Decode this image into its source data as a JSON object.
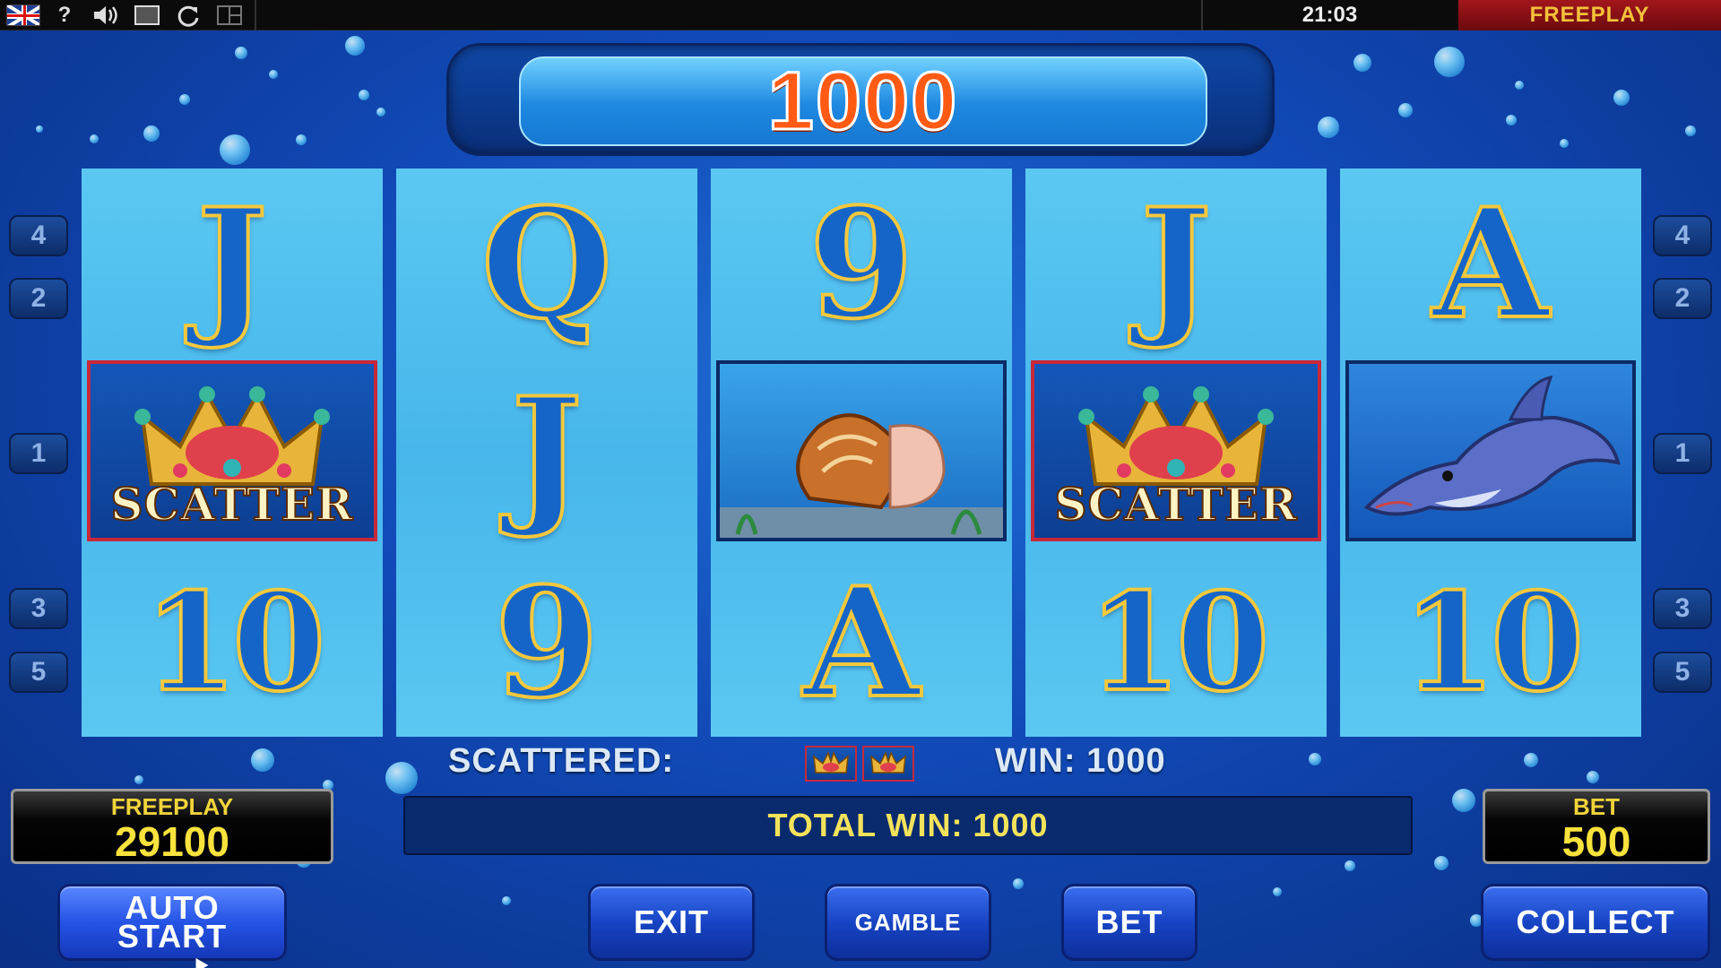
{
  "top_bar": {
    "icons": [
      "uk-flag-icon",
      "help-icon",
      "sound-icon",
      "fullscreen-icon",
      "reload-icon",
      "layout-icon"
    ],
    "help_glyph": "?",
    "clock": "21:03",
    "mode": "FREEPLAY"
  },
  "win_display": {
    "value": "1000"
  },
  "reels": [
    {
      "top": "J",
      "middle": "scatter",
      "bottom": "10"
    },
    {
      "top": "Q",
      "middle": "J",
      "bottom": "9"
    },
    {
      "top": "9",
      "middle": "shell",
      "bottom": "A"
    },
    {
      "top": "J",
      "middle": "scatter",
      "bottom": "10"
    },
    {
      "top": "A",
      "middle": "dolphin",
      "bottom": "10"
    }
  ],
  "scatter_text": "SCATTER",
  "line_markers": {
    "left": [
      "4",
      "2",
      "1",
      "3",
      "5"
    ],
    "right": [
      "4",
      "2",
      "1",
      "3",
      "5"
    ]
  },
  "info": {
    "scattered_label": "SCATTERED:",
    "scattered_count": 2,
    "win_label": "WIN: 1000",
    "total_win": "TOTAL WIN: 1000"
  },
  "credit": {
    "label": "FREEPLAY",
    "value": "29100"
  },
  "bet": {
    "label": "BET",
    "value": "500"
  },
  "buttons": {
    "auto_start": "AUTO START",
    "exit": "EXIT",
    "gamble": "GAMBLE",
    "bet": "BET",
    "collect": "COLLECT"
  },
  "colors": {
    "background": "#1149b6",
    "reel": "#47b6ea",
    "win_value": "#ff5a14",
    "total_win_text": "#f3e35a",
    "mode_bar": "#a2161c"
  }
}
